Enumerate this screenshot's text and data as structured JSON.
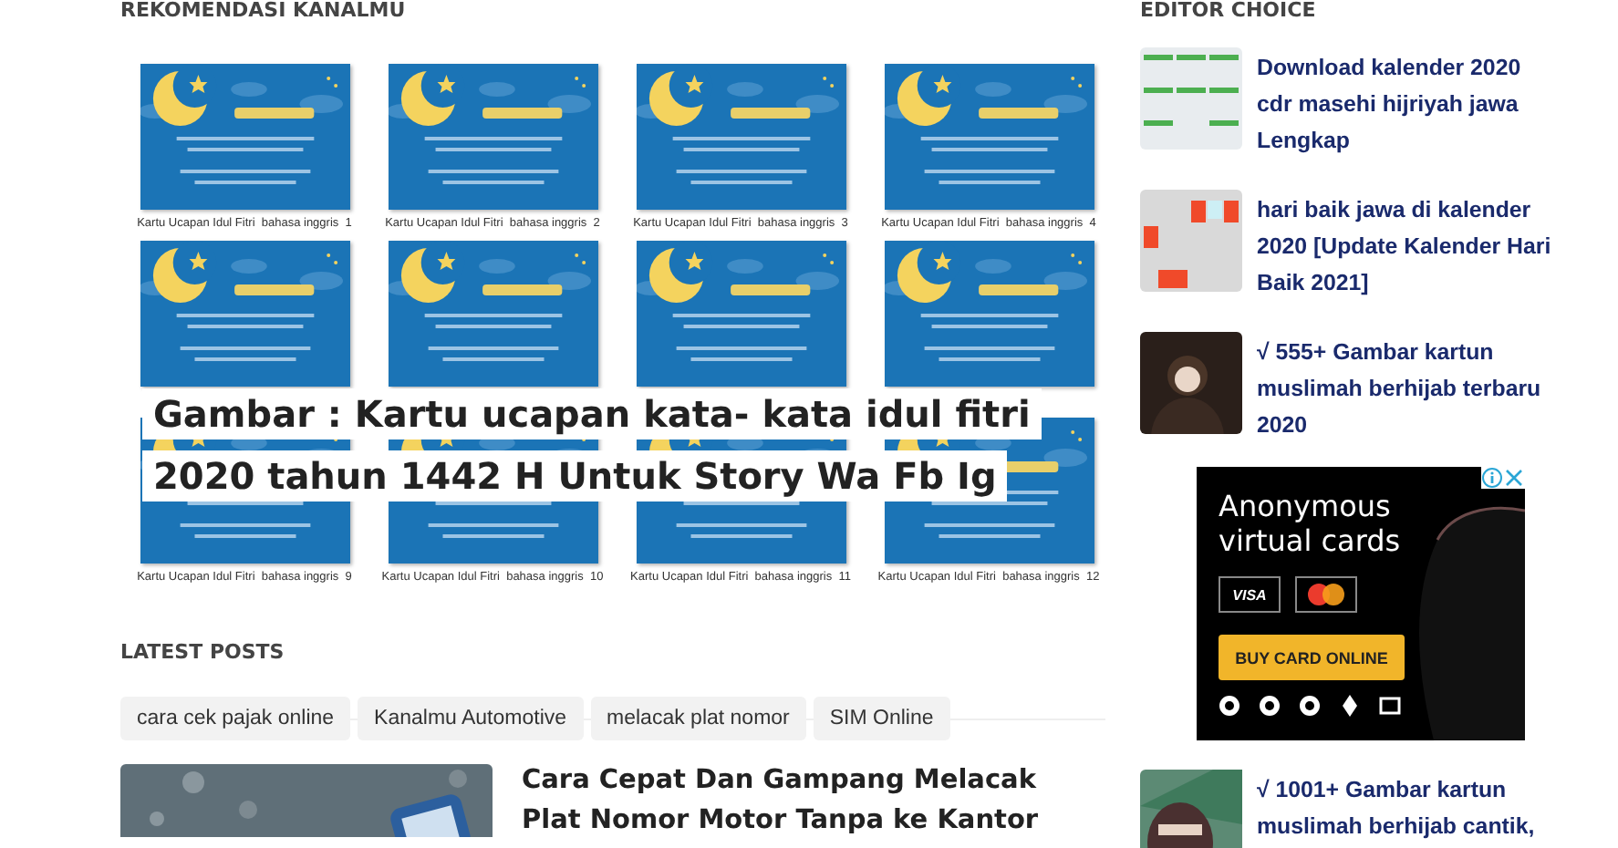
{
  "recommendations": {
    "heading": "REKOMENDASI KANALMU",
    "cards": [
      {
        "kind": "picture",
        "caption": "Kartu Ucapan Idul Fitri  bahasa inggris  1"
      },
      {
        "kind": "picture",
        "caption": "Kartu Ucapan Idul Fitri  bahasa inggris  2"
      },
      {
        "kind": "picture",
        "caption": "Kartu Ucapan Idul Fitri  bahasa inggris  3"
      },
      {
        "kind": "picture",
        "caption": "Kartu Ucapan Idul Fitri  bahasa inggris  4"
      },
      {
        "kind": "picture"
      },
      {
        "kind": "picture"
      },
      {
        "kind": "picture"
      },
      {
        "kind": "picture"
      },
      {
        "kind": "picture",
        "caption": "Kartu Ucapan Idul Fitri  bahasa inggris  9"
      },
      {
        "kind": "picture",
        "caption": "Kartu Ucapan Idul Fitri  bahasa inggris  10"
      },
      {
        "kind": "picture",
        "caption": "Kartu Ucapan Idul Fitri  bahasa inggris  11"
      },
      {
        "kind": "picture",
        "caption": "Kartu Ucapan Idul Fitri  bahasa inggris  12"
      }
    ],
    "overlay_title": "Gambar : Kartu ucapan kata- kata idul fitri 2020 tahun 1442 H Untuk Story Wa Fb Ig"
  },
  "latest_posts": {
    "heading": "LATEST POSTS",
    "tags": [
      "cara cek pajak online",
      "Kanalmu Automotive",
      "melacak plat nomor",
      "SIM Online"
    ],
    "post": {
      "title": "Cara Cepat Dan Gampang Melacak Plat Nomor Motor Tanpa ke Kantor"
    }
  },
  "editor_choice": {
    "heading": "EDITOR CHOICE",
    "items": [
      {
        "kind": "post",
        "title": "Download kalender 2020 cdr masehi hijriyah jawa Lengkap"
      },
      {
        "kind": "post",
        "title": "hari baik jawa di kalender 2020 [Update Kalender Hari Baik 2021]"
      },
      {
        "kind": "post",
        "title": "√ 555+ Gambar kartun muslimah berhijab terbaru 2020"
      },
      {
        "kind": "ad",
        "headline": "Anonymous virtual cards",
        "card_brand": "VISA",
        "cta": "BUY CARD ONLINE"
      },
      {
        "kind": "post",
        "title": "√ 1001+ Gambar kartun muslimah berhijab cantik,"
      }
    ]
  }
}
